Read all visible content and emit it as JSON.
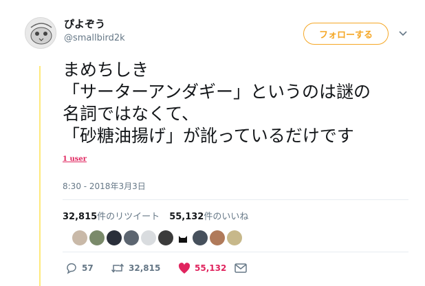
{
  "user": {
    "display_name": "ぴよぞう",
    "handle": "@smallbird2k",
    "follow_label": "フォローする"
  },
  "tweet": {
    "text": "まめちしき\n「サーターアンダギー」というのは謎の\n名詞ではなくて、\n「砂糖油揚げ」が訛っているだけです",
    "user_link": "1 user",
    "timestamp": "8:30 - 2018年3月3日"
  },
  "stats": {
    "retweets_count": "32,815",
    "retweets_label": "件のリツイート",
    "likes_count": "55,132",
    "likes_label": "件のいいね"
  },
  "actions": {
    "reply_count": "57",
    "retweet_count": "32,815",
    "like_count": "55,132"
  },
  "colors": {
    "accent": "#f5a623",
    "like": "#e0245e",
    "muted": "#657786",
    "rail": "#ffe97a"
  }
}
